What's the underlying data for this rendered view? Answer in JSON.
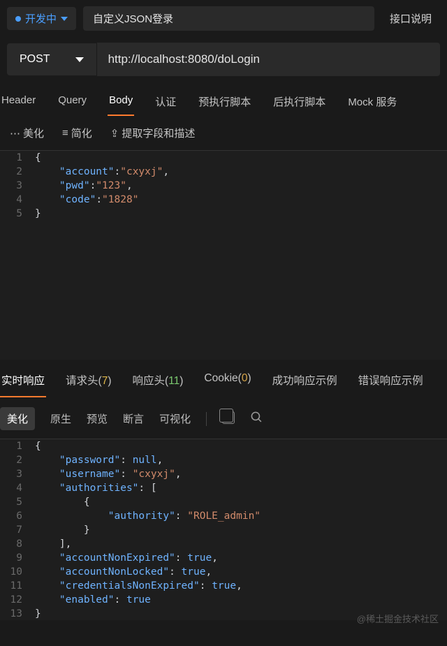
{
  "header": {
    "status_label": "开发中",
    "title": "自定义JSON登录",
    "doc_link": "接口说明"
  },
  "request": {
    "method": "POST",
    "url": "http://localhost:8080/doLogin"
  },
  "req_tabs": [
    "Header",
    "Query",
    "Body",
    "认证",
    "预执行脚本",
    "后执行脚本",
    "Mock 服务"
  ],
  "req_tab_active": 2,
  "req_toolbar": {
    "beautify": "美化",
    "simplify": "简化",
    "extract": "提取字段和描述"
  },
  "request_body_lines": [
    {
      "n": 1,
      "indent": 0,
      "tokens": [
        [
          "p",
          "{"
        ]
      ]
    },
    {
      "n": 2,
      "indent": 1,
      "tokens": [
        [
          "k",
          "\"account\""
        ],
        [
          "p",
          ":"
        ],
        [
          "s",
          "\"cxyxj\""
        ],
        [
          "p",
          ","
        ]
      ]
    },
    {
      "n": 3,
      "indent": 1,
      "tokens": [
        [
          "k",
          "\"pwd\""
        ],
        [
          "p",
          ":"
        ],
        [
          "s",
          "\"123\""
        ],
        [
          "p",
          ","
        ]
      ]
    },
    {
      "n": 4,
      "indent": 1,
      "tokens": [
        [
          "k",
          "\"code\""
        ],
        [
          "p",
          ":"
        ],
        [
          "s",
          "\"1828\""
        ]
      ]
    },
    {
      "n": 5,
      "indent": 0,
      "tokens": [
        [
          "p",
          "}"
        ]
      ]
    }
  ],
  "resp_tabs": [
    {
      "label": "实时响应",
      "count": null,
      "active": true
    },
    {
      "label": "请求头",
      "count": "7",
      "countClass": "cnt-y"
    },
    {
      "label": "响应头",
      "count": "11",
      "countClass": "cnt-g"
    },
    {
      "label": "Cookie",
      "count": "0",
      "countClass": "cnt-o"
    },
    {
      "label": "成功响应示例",
      "count": null
    },
    {
      "label": "错误响应示例",
      "count": null
    }
  ],
  "resp_toolbar": {
    "beautify": "美化",
    "raw": "原生",
    "preview": "预览",
    "assertion": "断言",
    "visualize": "可视化"
  },
  "response_body_lines": [
    {
      "n": 1,
      "indent": 0,
      "tokens": [
        [
          "p",
          "{"
        ]
      ]
    },
    {
      "n": 2,
      "indent": 1,
      "tokens": [
        [
          "k",
          "\"password\""
        ],
        [
          "p",
          ": "
        ],
        [
          "u",
          "null"
        ],
        [
          "p",
          ","
        ]
      ]
    },
    {
      "n": 3,
      "indent": 1,
      "tokens": [
        [
          "k",
          "\"username\""
        ],
        [
          "p",
          ": "
        ],
        [
          "s",
          "\"cxyxj\""
        ],
        [
          "p",
          ","
        ]
      ]
    },
    {
      "n": 4,
      "indent": 1,
      "tokens": [
        [
          "k",
          "\"authorities\""
        ],
        [
          "p",
          ": ["
        ]
      ]
    },
    {
      "n": 5,
      "indent": 2,
      "tokens": [
        [
          "p",
          "{"
        ]
      ]
    },
    {
      "n": 6,
      "indent": 3,
      "tokens": [
        [
          "k",
          "\"authority\""
        ],
        [
          "p",
          ": "
        ],
        [
          "s",
          "\"ROLE_admin\""
        ]
      ]
    },
    {
      "n": 7,
      "indent": 2,
      "tokens": [
        [
          "p",
          "}"
        ]
      ]
    },
    {
      "n": 8,
      "indent": 1,
      "tokens": [
        [
          "p",
          "],"
        ]
      ]
    },
    {
      "n": 9,
      "indent": 1,
      "tokens": [
        [
          "k",
          "\"accountNonExpired\""
        ],
        [
          "p",
          ": "
        ],
        [
          "b",
          "true"
        ],
        [
          "p",
          ","
        ]
      ]
    },
    {
      "n": 10,
      "indent": 1,
      "tokens": [
        [
          "k",
          "\"accountNonLocked\""
        ],
        [
          "p",
          ": "
        ],
        [
          "b",
          "true"
        ],
        [
          "p",
          ","
        ]
      ]
    },
    {
      "n": 11,
      "indent": 1,
      "tokens": [
        [
          "k",
          "\"credentialsNonExpired\""
        ],
        [
          "p",
          ": "
        ],
        [
          "b",
          "true"
        ],
        [
          "p",
          ","
        ]
      ]
    },
    {
      "n": 12,
      "indent": 1,
      "tokens": [
        [
          "k",
          "\"enabled\""
        ],
        [
          "p",
          ": "
        ],
        [
          "b",
          "true"
        ]
      ]
    },
    {
      "n": 13,
      "indent": 0,
      "tokens": [
        [
          "p",
          "}"
        ]
      ]
    }
  ],
  "watermark": "@稀土掘金技术社区"
}
